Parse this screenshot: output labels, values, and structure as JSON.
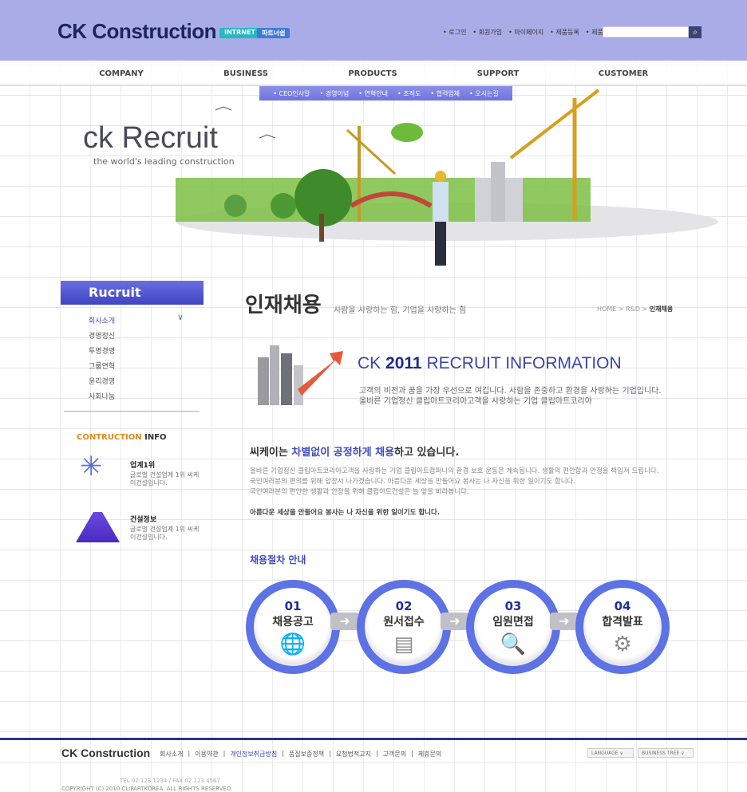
{
  "header": {
    "logo": "CK Construction",
    "badges": [
      "INTRNET",
      "파트너쉽"
    ],
    "util_links": [
      "로그인",
      "회원가입",
      "마이페이지",
      "제품등록",
      "제품검색"
    ],
    "search_placeholder": ""
  },
  "nav": {
    "items": [
      "COMPANY",
      "BUSINESS",
      "PRODUCTS",
      "SUPPORT",
      "CUSTOMER"
    ],
    "subnav": [
      "CEO인사말",
      "경영이념",
      "연혁안내",
      "조직도",
      "협력업체",
      "오시는길"
    ]
  },
  "hero": {
    "title": "ck Recruit",
    "subtitle": "the world's leading construction"
  },
  "sidebar": {
    "title": "Rucruit",
    "items": [
      "회사소개",
      "경영정신",
      "투명경영",
      "그룹연혁",
      "윤리경영",
      "사회나눔"
    ],
    "info_title_accent": "CONTRUCTION",
    "info_title": "INFO",
    "info": [
      {
        "title": "업계1위",
        "text": "글로벌 건설업계 1위 씨케이건설입니다."
      },
      {
        "title": "건설정보",
        "text": "글로벌 건설업계 1위 씨케이건설입니다."
      }
    ]
  },
  "main": {
    "title": "인재채용",
    "subtitle": "사람을 사랑하는 힘, 기업을 사랑하는 힘",
    "breadcrumb": {
      "path": "HOME > R&D > ",
      "current": "인재채용"
    },
    "recruit": {
      "ck": "CK",
      "year": "2011",
      "rest": "RECRUIT INFORMATION",
      "lines": [
        "고객의 비전과 꿈을 가장 우선으로 여깁니다. 사람을 존중하고 환경을 사랑하는 기업입니다.",
        "올바른 기업정신 클립아트코리아고객을 사랑하는 기업 클립아트코리아"
      ]
    },
    "fair": {
      "pre": "씨케이는 ",
      "accent": "차별없이 공정하게 채용",
      "post": "하고 있습니다."
    },
    "paragraphs": [
      "올바른 기업정신 클립아트코리아고객을 사랑하는 기업 클립아트컴퍼니의 환경 보호 운동은 계속됩니다. 생활의 편안함과 안정을 책임져 드립니다.",
      "국민여러분의 편의를 위해 앞장서 나가겠습니다. 아름다운 세상을 만들어요 봉사는 나 자신을 위한 일이기도 합니다.",
      "국민여러분의 편안한 생활과 안정을 위해 클립아트건설은 늘 앞을 바라봅니다.",
      "아름다운 세상을 만들어요 봉사는 나 자신을 위한 일이기도 합니다."
    ],
    "steps_title_accent": "채용절차",
    "steps_title": " 안내",
    "steps": [
      {
        "num": "01",
        "label": "채용공고",
        "icon": "globe-icon"
      },
      {
        "num": "02",
        "label": "원서접수",
        "icon": "documents-icon"
      },
      {
        "num": "03",
        "label": "임원면접",
        "icon": "magnifier-clipboard-icon"
      },
      {
        "num": "04",
        "label": "합격발표",
        "icon": "gears-icon"
      }
    ]
  },
  "footer": {
    "logo": "CK Construction",
    "links": [
      "회사소개",
      "이용약관",
      "개인정보취급방침",
      "품질보증정책",
      "요청법적고지",
      "고객문의",
      "제휴문의"
    ],
    "selects": [
      "LANGUAGE",
      "BUSINESS TREE"
    ],
    "address": "TEL 02.123.1234 / FAX 02.123.4567",
    "copyright": "COPYRIGHT (C) 2010 CLIPARTKOREA. ALL RIGHTS RESERVED."
  },
  "colors": {
    "header_bg": "#aaace8",
    "accent": "#3c4bc0",
    "step_ring": "#5d72e4"
  }
}
